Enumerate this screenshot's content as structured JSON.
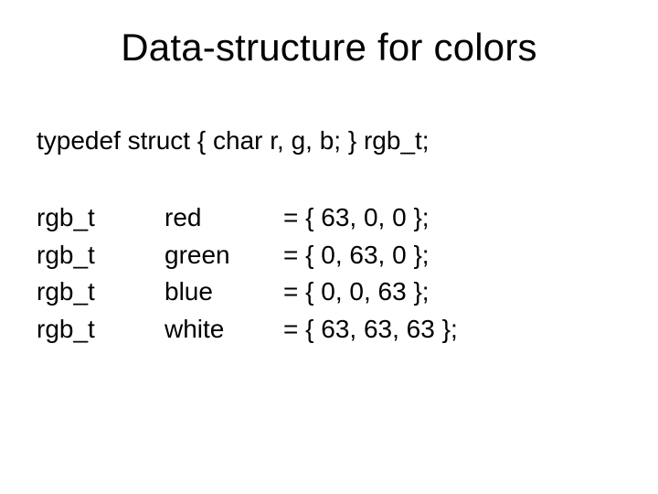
{
  "title": "Data-structure for colors",
  "typedef": "typedef struct { char  r, g, b; } rgb_t;",
  "decls": [
    {
      "type": "rgb_t",
      "name": "red",
      "value": "= { 63, 0, 0 };"
    },
    {
      "type": "rgb_t",
      "name": "green",
      "value": "= { 0, 63, 0 };"
    },
    {
      "type": "rgb_t",
      "name": "blue",
      "value": "= { 0, 0, 63 };"
    },
    {
      "type": "rgb_t",
      "name": "white",
      "value": "= { 63, 63, 63 };"
    }
  ]
}
